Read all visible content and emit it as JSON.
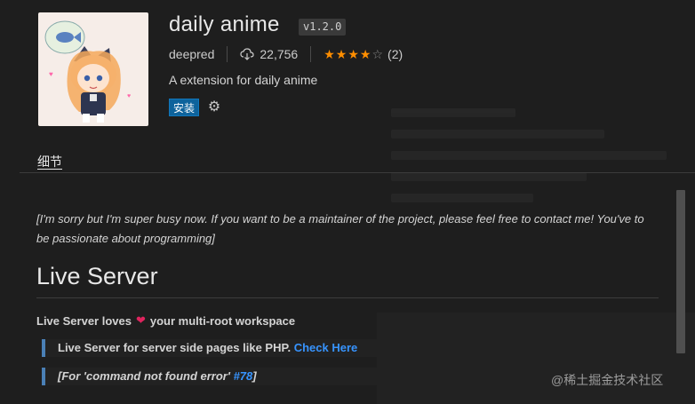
{
  "extension": {
    "name": "daily anime",
    "version": "v1.2.0",
    "publisher": "deepred",
    "installs": "22,756",
    "rating": 4,
    "rating_max": 5,
    "rating_count": "(2)",
    "description": "A extension for daily anime",
    "install_label": "安装"
  },
  "icons": {
    "logo": "anime-girl-logo",
    "installs_icon": "cloud-download-icon",
    "settings_icon": "gear-icon",
    "star_icon": "star-icon"
  },
  "tabs": [
    {
      "label": "细节"
    }
  ],
  "readme": {
    "note": "[I'm sorry but I'm super busy now. If you want to be a maintainer of the project, please feel free to contact me! You've to be passionate about programming]",
    "heading": "Live Server",
    "loves_prefix": "Live Server loves",
    "loves_suffix": "your multi-root workspace",
    "quote1_text": "Live Server for server side pages like PHP.",
    "quote1_link": "Check Here",
    "quote2_text": "[For 'command not found error'",
    "quote2_link": "#78",
    "quote2_close": "]"
  },
  "watermark": "@稀土掘金技术社区",
  "colors": {
    "background": "#1e1e1e",
    "accent_button": "#0e639c",
    "link": "#3794ff",
    "star": "#ff8e00",
    "quote_border": "#4a80b6"
  }
}
